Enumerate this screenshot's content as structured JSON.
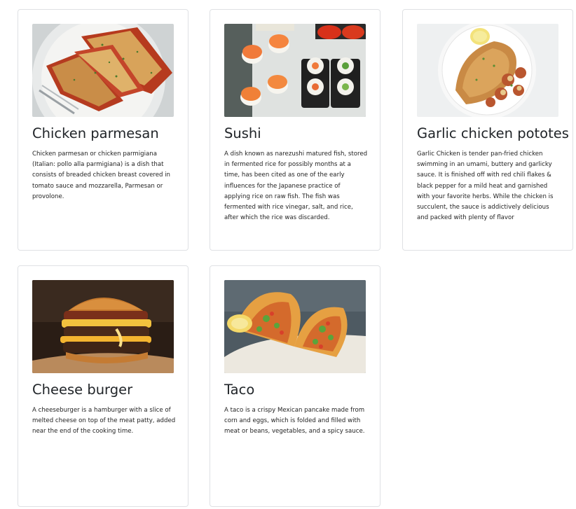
{
  "cards": [
    {
      "title": "Chicken parmesan",
      "text": "Chicken parmesan or chicken parmigiana (Italian: pollo alla parmigiana) is a dish that consists of breaded chicken breast covered in tomato sauce and mozzarella, Parmesan or provolone.",
      "image_icon": "chicken-parmesan-photo"
    },
    {
      "title": "Sushi",
      "text": "A dish known as narezushi matured fish, stored in fermented rice for possibly months at a time, has been cited as one of the early influences for the Japanese practice of applying rice on raw fish. The fish was fermented with rice vinegar, salt, and rice, after which the rice was discarded.",
      "image_icon": "sushi-photo"
    },
    {
      "title": "Garlic chicken pototes",
      "text": "Garlic Chicken is tender pan-fried chicken swimming in an umami, buttery and garlicky sauce. It is finished off with red chili flakes & black pepper for a mild heat and garnished with your favorite herbs. While the chicken is succulent, the sauce is addictively delicious and packed with plenty of flavor",
      "image_icon": "garlic-chicken-potatoes-photo"
    },
    {
      "title": "Cheese burger",
      "text": "A cheeseburger is a hamburger with a slice of melted cheese on top of the meat patty, added near the end of the cooking time.",
      "image_icon": "cheese-burger-photo"
    },
    {
      "title": "Taco",
      "text": "A taco is a crispy Mexican pancake made from corn and eggs, which is folded and filled with meat or beans, vegetables, and a spicy sauce.",
      "image_icon": "taco-photo"
    }
  ]
}
